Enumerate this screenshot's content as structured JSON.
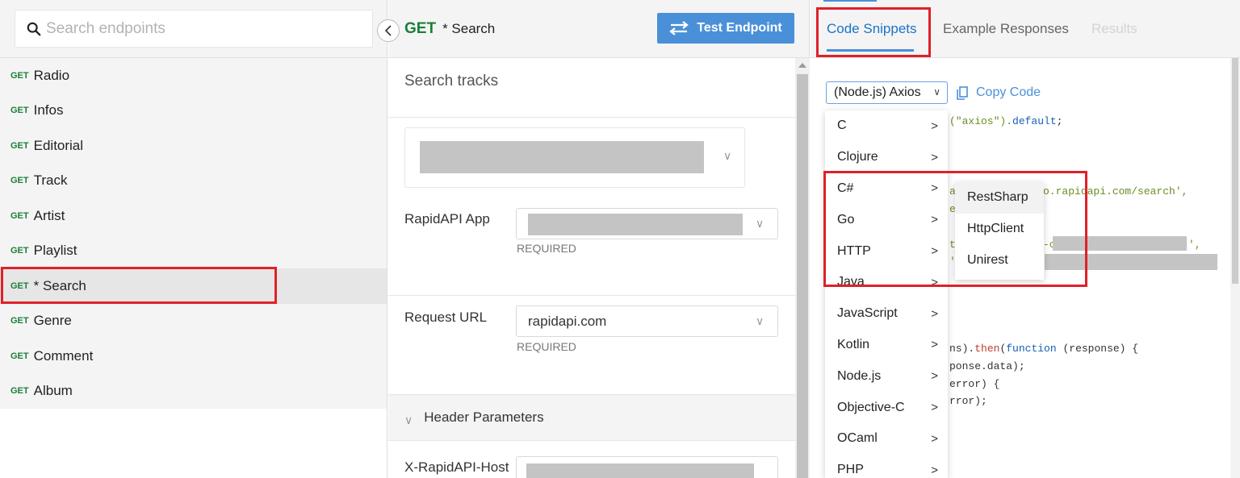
{
  "search": {
    "placeholder": "Search endpoints"
  },
  "endpoints": [
    {
      "method": "GET",
      "name": "Radio"
    },
    {
      "method": "GET",
      "name": "Infos"
    },
    {
      "method": "GET",
      "name": "Editorial"
    },
    {
      "method": "GET",
      "name": "Track"
    },
    {
      "method": "GET",
      "name": "Artist"
    },
    {
      "method": "GET",
      "name": "Playlist"
    },
    {
      "method": "GET",
      "name": "* Search"
    },
    {
      "method": "GET",
      "name": "Genre"
    },
    {
      "method": "GET",
      "name": "Comment"
    },
    {
      "method": "GET",
      "name": "Album"
    }
  ],
  "selected_endpoint": {
    "method": "GET",
    "name": "* Search"
  },
  "test_button": "Test Endpoint",
  "description": "Search tracks",
  "params": {
    "app_label": "RapidAPI App",
    "app_required": "REQUIRED",
    "url_label": "Request URL",
    "url_value": "rapidapi.com",
    "url_required": "REQUIRED",
    "header_section": "Header Parameters",
    "host_label": "X-RapidAPI-Host"
  },
  "tabs": [
    "Code Snippets",
    "Example Responses",
    "Results"
  ],
  "snippet": {
    "language_select": "(Node.js) Axios",
    "copy_label": "Copy Code"
  },
  "code_fragments": {
    "l1a": "(\"axios\").",
    "l1b": "default",
    "l1c": ";",
    "l2a": "a",
    "l2b": "o.rapi",
    "l2c": "dapi.com/search',",
    "l3": "e",
    "l4a": "t",
    "l4b": "-c",
    "l4c": "',",
    "l5": "'",
    "l6a": "ns).",
    "l6b": "then",
    "l6c": "(",
    "l6d": "function",
    "l6e": " (response) {",
    "l7": "ponse.data);",
    "l8": "error) {",
    "l9": "rror);"
  },
  "languages": [
    "C",
    "Clojure",
    "C#",
    "Go",
    "HTTP",
    "Java",
    "JavaScript",
    "Kotlin",
    "Node.js",
    "Objective-C",
    "OCaml",
    "PHP"
  ],
  "csharp_submenu": [
    "RestSharp",
    "HttpClient",
    "Unirest"
  ],
  "colors": {
    "accent": "#4a90d9",
    "get_method": "#1a7f37",
    "highlight": "#e0202a"
  }
}
